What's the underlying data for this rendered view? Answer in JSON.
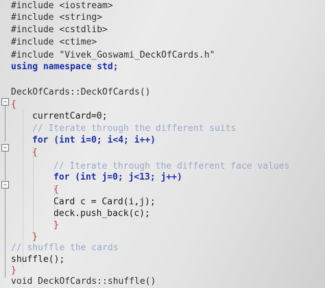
{
  "code": {
    "lines": [
      "#include <iostream>",
      "#include <string>",
      "#include <cstdlib>",
      "#include <ctime>",
      "#include \"Vivek_Goswami_DeckOfCards.h\"",
      "using namespace std;",
      "",
      "DeckOfCards::DeckOfCards()",
      "{",
      "currentCard=0;",
      "// Iterate through the different suits",
      "for (int i=0; i<4; i++)",
      "{",
      "// Iterate through the different face values",
      "for (int j=0; j<13; j++)",
      "{",
      "Card c = Card(i,j);",
      "deck.push_back(c);",
      "}",
      "}",
      "// shuffle the cards",
      "shuffle();",
      "}",
      "void DeckOfCards::shuffle()"
    ]
  },
  "fold_markers": {
    "collapse_symbol": "−"
  }
}
